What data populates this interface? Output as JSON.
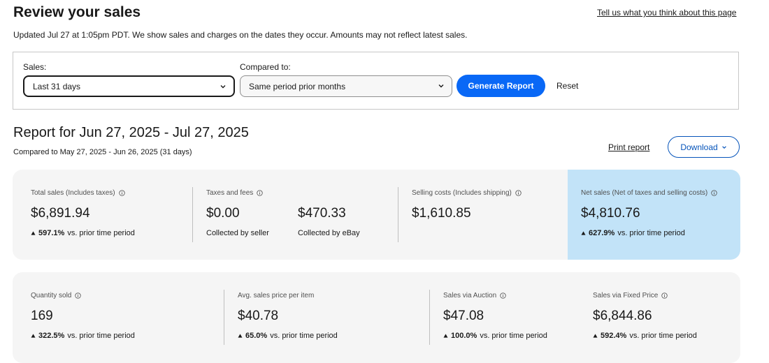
{
  "header": {
    "title": "Review your sales",
    "feedback_link": "Tell us what you think about this page",
    "updated_note": "Updated Jul 27 at 1:05pm PDT. We show sales and charges on the dates they occur. Amounts may not reflect latest sales."
  },
  "filters": {
    "sales_label": "Sales:",
    "sales_value": "Last 31 days",
    "compare_label": "Compared to:",
    "compare_value": "Same period prior months",
    "generate_label": "Generate Report",
    "reset_label": "Reset"
  },
  "report": {
    "title": "Report for Jun 27, 2025 - Jul 27, 2025",
    "compared_range": "Compared to May 27, 2025 - Jun 26, 2025 (31 days)",
    "print_label": "Print report",
    "download_label": "Download"
  },
  "summary": {
    "total_sales": {
      "label": "Total sales (Includes taxes)",
      "value": "$6,891.94",
      "change": "597.1%",
      "change_suffix": "vs. prior time period"
    },
    "taxes_fees": {
      "label": "Taxes and fees",
      "seller_value": "$0.00",
      "seller_caption": "Collected by seller",
      "ebay_value": "$470.33",
      "ebay_caption": "Collected by eBay"
    },
    "selling_costs": {
      "label": "Selling costs (Includes shipping)",
      "value": "$1,610.85"
    },
    "net_sales": {
      "label": "Net sales (Net of taxes and selling costs)",
      "value": "$4,810.76",
      "change": "627.9%",
      "change_suffix": "vs. prior time period"
    }
  },
  "details": {
    "quantity_sold": {
      "label": "Quantity sold",
      "value": "169",
      "change": "322.5%",
      "change_suffix": "vs. prior time period"
    },
    "avg_price": {
      "label": "Avg. sales price per item",
      "value": "$40.78",
      "change": "65.0%",
      "change_suffix": "vs. prior time period"
    },
    "auction": {
      "label": "Sales via Auction",
      "value": "$47.08",
      "change": "100.0%",
      "change_suffix": "vs. prior time period"
    },
    "fixed_price": {
      "label": "Sales via Fixed Price",
      "value": "$6,844.86",
      "change": "592.4%",
      "change_suffix": "vs. prior time period"
    }
  },
  "icons": {
    "info": "info-circle-icon",
    "up": "up-triangle-icon",
    "chevron": "chevron-down-icon"
  },
  "colors": {
    "primary_button": "#0968f6",
    "link_blue": "#0654ba",
    "card_bg": "#f5f5f5",
    "net_sales_bg": "#c2e3f8"
  }
}
